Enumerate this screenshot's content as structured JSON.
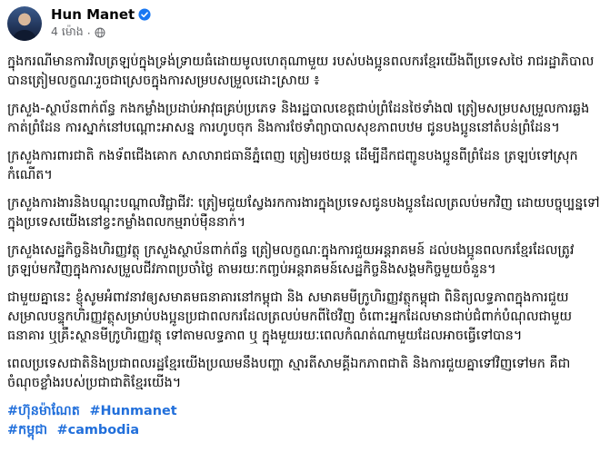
{
  "author": {
    "name": "Hun Manet",
    "timestamp": "4 ម៉ោង",
    "verified": true
  },
  "icons": {
    "verified": "verified-badge-icon",
    "privacy": "globe-icon"
  },
  "colors": {
    "link": "#216fdb",
    "verified": "#1877f2",
    "muted": "#65676b"
  },
  "paragraphs": [
    "ក្នុងករណីមានការវិលត្រឡប់ក្នុងទ្រង់ទ្រាយធំដោយមូលហេតុណាមួយ របស់បងប្អូនពលករខ្មែរយើងពីប្រទេសថៃ រាជរដ្ឋាភិបាលបានត្រៀមលក្ខណៈរួចជាស្រេចក្នុងការសម្របសម្រួលដោះស្រាយ ៖",
    "ក្រសួង-ស្ថាប័នពាក់ព័ន្ធ កងកម្លាំងប្រដាប់អាវុធគ្រប់ប្រភេទ និងរដ្ឋបាលខេត្តជាប់ព្រំដែនថៃទាំង៧ ត្រៀមសម្របសម្រួលការឆ្លងកាត់ព្រំដែន ការស្នាក់នៅបណ្តោះអាសន្ន ការហូបចុក និងការថែទាំព្យាបាលសុខភាពបឋម ជូនបងប្អូននៅតំបន់ព្រំដែន។",
    "ក្រសួងការពារជាតិ កងទ័ពជើងគោក សាលារាជធានីភ្នំពេញ ត្រៀមរថយន្ត ដើម្បីដឹកជញ្ជូនបងប្អូនពីព្រំដែន ត្រឡប់ទៅស្រុកកំណើត។",
    "ក្រសួងការងារនិងបណ្តុះបណ្តាលវិជ្ជាជីវៈ ត្រៀមជួយស្វែងរកការងារក្នុងប្រទេសជូនបងប្អូនដែលត្រលប់មកវិញ ដោយបច្ចុប្បន្នទៅក្នុងប្រទេសយើងនៅខ្វះកម្លាំងពលកម្មរាប់ម៉ឺននាក់។",
    "ក្រសួងសេដ្ឋកិច្ចនិងហិរញ្ញវត្ថុ ក្រសួងស្ថាប័នពាក់ព័ន្ធ ត្រៀមលក្ខណៈក្នុងការជួយអន្តរាគមន៍ ដល់បងប្អូនពលករខ្មែរដែលត្រូវត្រឡប់មកវិញក្នុងការសម្រួលជីវភាពប្រចាំថ្ងៃ តាមរយៈកញ្ចប់អន្តរាគមន៍សេដ្ឋកិច្ចនិងសង្គមកិច្ចមួយចំនួន។",
    "ជាមួយគ្នានេះ ខ្ញុំសូមអំពាវនាវឲ្យសមាគមធនាគារនៅកម្ពុជា និង សមាគមមីក្រូហិរញ្ញវត្ថុកម្ពុជា ពិនិត្យលទ្ធភាពក្នុងការជួយសម្រាលបន្ទុកហិរញ្ញវត្ថុសម្រាប់បងប្អូនប្រជាពលករដែលត្រលប់មកពីថៃវិញ ចំពោះអ្នកដែលមានជាប់ជំពាក់បំណុលជាមួយធនាគារ ឬគ្រឹះស្ថានមីក្រូហិរញ្ញវត្ថុ ទៅតាមលទ្ធភាព ឬ ក្នុងមួយរយៈពេលកំណត់ណាមួយដែលអាចធ្វើទៅបាន។",
    "ពេលប្រទេសជាតិនិងប្រជាពលរដ្ឋខ្មែរយើងប្រឈមនឹងបញ្ហា ស្មារតីសាមគ្គីឯកភាពជាតិ និងការជួយគ្នាទៅវិញទៅមក គឺជាចំណុចខ្លាំងរបស់ប្រជាជាតិខ្មែរយើង។"
  ],
  "hashtags": {
    "line1": [
      "#ហ៊ុនម៉ាណែត",
      "#Hunmanet"
    ],
    "line2": [
      "#កម្ពុជា",
      "#cambodia"
    ]
  }
}
